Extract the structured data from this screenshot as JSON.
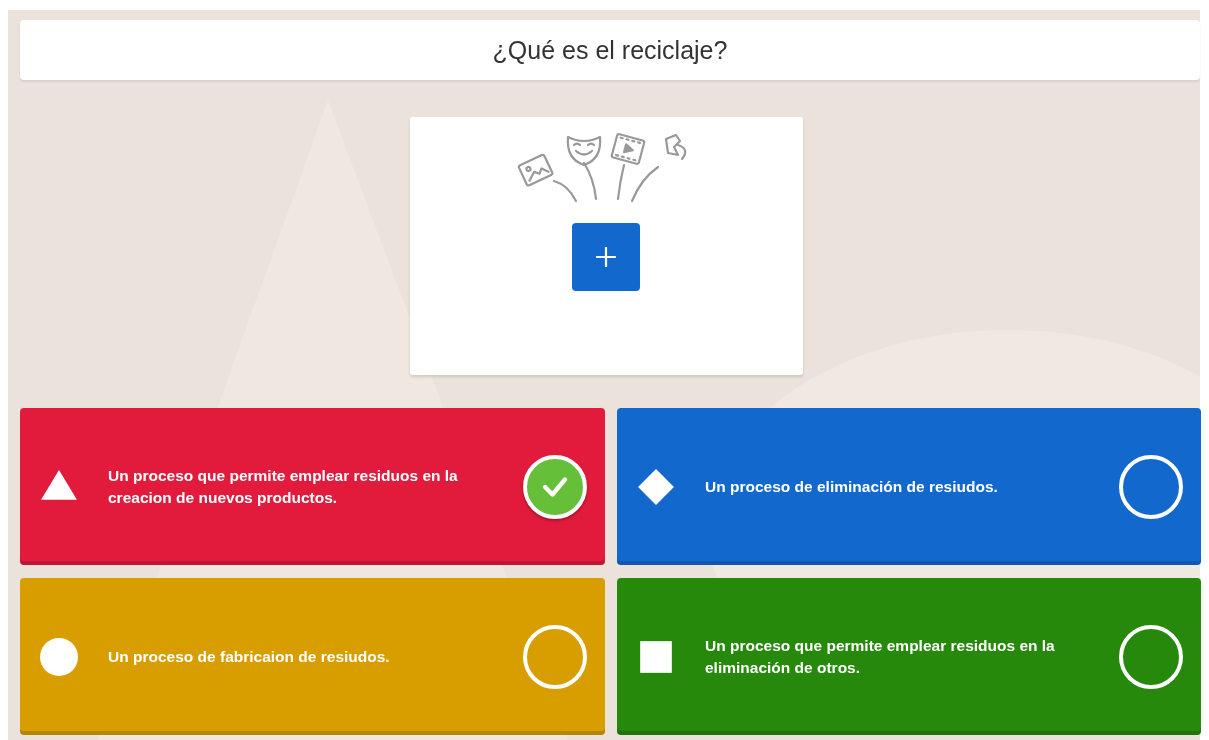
{
  "question": {
    "title": "¿Qué es el reciclaje?"
  },
  "answers": [
    {
      "kind": "triangle",
      "text": "Un proceso que permite emplear residuos en la creacion de nuevos productos.",
      "color": "#e21b3c",
      "correct": true
    },
    {
      "kind": "diamond",
      "text": "Un proceso de eliminación de resiudos.",
      "color": "#1368ce",
      "correct": false
    },
    {
      "kind": "circle",
      "text": "Un proceso de fabricaion de resiudos.",
      "color": "#d89e00",
      "correct": false
    },
    {
      "kind": "square",
      "text": "Un proceso que permite emplear residuos en la eliminación de otros.",
      "color": "#26890c",
      "correct": false
    }
  ]
}
